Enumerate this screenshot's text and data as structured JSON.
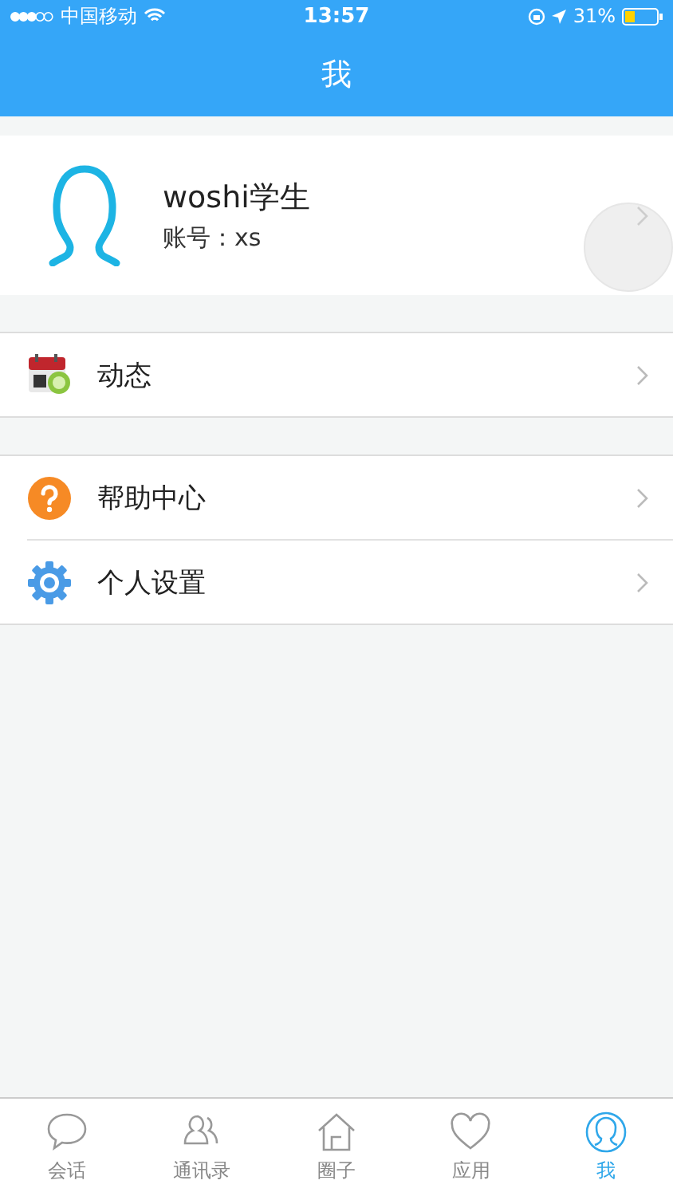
{
  "status_bar": {
    "carrier": "中国移动",
    "time": "13:57",
    "battery": "31%"
  },
  "nav": {
    "title": "我"
  },
  "profile": {
    "name": "woshi学生",
    "account": "账号：xs"
  },
  "groups": [
    [
      {
        "kind": "calendar",
        "label": "动态"
      }
    ],
    [
      {
        "kind": "help",
        "label": "帮助中心"
      },
      {
        "kind": "settings",
        "label": "个人设置"
      }
    ]
  ],
  "tabs": [
    {
      "kind": "chat",
      "label": "会话",
      "selected": false
    },
    {
      "kind": "contacts",
      "label": "通讯录",
      "selected": false
    },
    {
      "kind": "home",
      "label": "圈子",
      "selected": false
    },
    {
      "kind": "heart",
      "label": "应用",
      "selected": false
    },
    {
      "kind": "me",
      "label": "我",
      "selected": true
    }
  ]
}
